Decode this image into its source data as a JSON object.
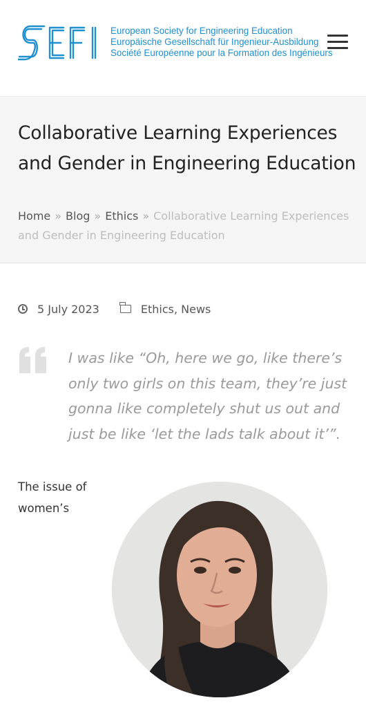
{
  "header": {
    "logo_text": "SEFI",
    "org_name_en": "European Society for Engineering Education",
    "org_name_de": "Europäische Gesellschaft für Ingenieur-Ausbildung",
    "org_name_fr": "Société Européenne pour la Formation des Ingénieurs",
    "menu_icon": "hamburger-menu-icon",
    "brand_color": "#1f8fd0"
  },
  "page": {
    "title": "Collaborative Learning Experiences and Gender in Engineering Education",
    "breadcrumb": {
      "home": "Home",
      "blog": "Blog",
      "category": "Ethics",
      "separator": "»",
      "current": "Collaborative Learning Experiences and Gender in Engineering Education"
    }
  },
  "post": {
    "date": "5 July 2023",
    "date_icon": "clock-icon",
    "category_icon": "folder-icon",
    "categories": [
      "Ethics",
      "News"
    ],
    "category_separator": ",",
    "quote": "I was like “Oh, here we go, like there’s only two girls on this team, they’re just gonna like completely shut us out and just be like ‘let the lads talk about it’”.",
    "body_start": "The issue of women’s"
  }
}
